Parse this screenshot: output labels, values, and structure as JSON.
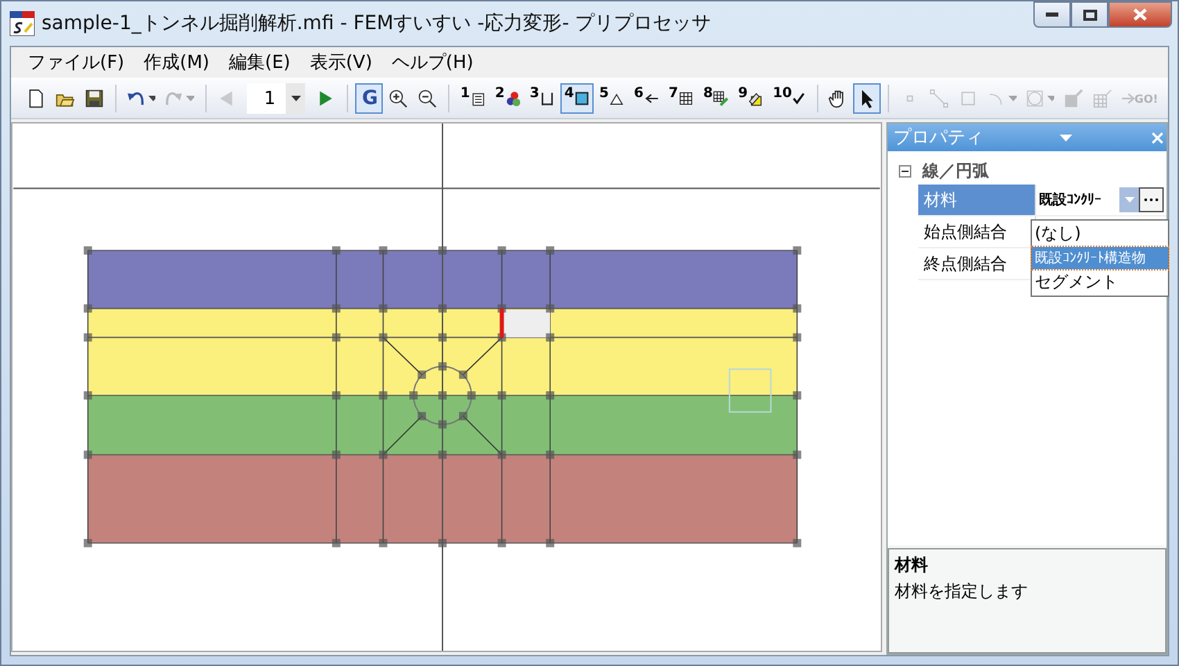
{
  "window": {
    "title": "sample-1_トンネル掘削解析.mfi - FEMすいすい -応力変形- プリプロセッサ"
  },
  "menu": [
    "ファイル(F)",
    "作成(M)",
    "編集(E)",
    "表示(V)",
    "ヘルプ(H)"
  ],
  "toolbar": [
    {
      "kind": "new",
      "disabled": false,
      "selected": false
    },
    {
      "kind": "open",
      "disabled": false,
      "selected": false
    },
    {
      "kind": "save",
      "disabled": false,
      "selected": false
    },
    {
      "kind": "sep"
    },
    {
      "kind": "undo",
      "disabled": false,
      "selected": false
    },
    {
      "kind": "redo",
      "disabled": true,
      "selected": false
    },
    {
      "kind": "sep"
    },
    {
      "kind": "prev",
      "disabled": true,
      "selected": false
    },
    {
      "kind": "page",
      "value": "1"
    },
    {
      "kind": "next",
      "disabled": false,
      "selected": false
    },
    {
      "kind": "sep"
    },
    {
      "kind": "global",
      "label": "G",
      "disabled": false,
      "selected": true
    },
    {
      "kind": "zoom-in",
      "disabled": false,
      "selected": false
    },
    {
      "kind": "zoom-out",
      "disabled": false,
      "selected": false
    },
    {
      "kind": "sep"
    },
    {
      "kind": "step-list",
      "label": "1",
      "disabled": false,
      "selected": false
    },
    {
      "kind": "step-circles",
      "label": "2",
      "disabled": false,
      "selected": false
    },
    {
      "kind": "step-dimension",
      "label": "3",
      "disabled": false,
      "selected": false
    },
    {
      "kind": "step-square",
      "label": "4",
      "disabled": false,
      "selected": true
    },
    {
      "kind": "step-triangle",
      "label": "5",
      "disabled": false,
      "selected": false
    },
    {
      "kind": "step-arrow",
      "label": "6",
      "disabled": false,
      "selected": false
    },
    {
      "kind": "step-grid",
      "label": "7",
      "disabled": false,
      "selected": false
    },
    {
      "kind": "step-grid-pencil",
      "label": "8",
      "disabled": false,
      "selected": false
    },
    {
      "kind": "step-pencil",
      "label": "9",
      "disabled": false,
      "selected": false
    },
    {
      "kind": "step-check",
      "label": "10",
      "disabled": false,
      "selected": false
    },
    {
      "kind": "sep"
    },
    {
      "kind": "hand",
      "disabled": false,
      "selected": false
    },
    {
      "kind": "pointer",
      "disabled": false,
      "selected": true
    },
    {
      "kind": "sep"
    },
    {
      "kind": "point",
      "disabled": true,
      "selected": false
    },
    {
      "kind": "line",
      "disabled": true,
      "selected": false
    },
    {
      "kind": "rect",
      "disabled": true,
      "selected": false
    },
    {
      "kind": "arc",
      "disabled": true,
      "selected": false
    },
    {
      "kind": "circle",
      "disabled": true,
      "selected": false
    },
    {
      "kind": "fill",
      "disabled": true,
      "selected": false
    },
    {
      "kind": "mesh",
      "disabled": true,
      "selected": false
    },
    {
      "kind": "go",
      "label": "GO!",
      "disabled": true,
      "selected": false
    }
  ],
  "canvas": {
    "layers": [
      {
        "color": "#7b7aba"
      },
      {
        "color": "#fbef7e"
      },
      {
        "color": "#82bf75"
      },
      {
        "color": "#c4827d"
      }
    ]
  },
  "properties": {
    "title": "プロパティ",
    "category": {
      "label": "線／円弧",
      "expanded": true
    },
    "rows": [
      {
        "name": "材料",
        "value": "既設ｺﾝｸﾘｰ",
        "selected": true
      },
      {
        "name": "始点側結合",
        "selected": false
      },
      {
        "name": "終点側結合",
        "selected": false
      }
    ],
    "dropdown": [
      {
        "label": "(なし)",
        "selected": false
      },
      {
        "label": "既設ｺﾝｸﾘｰﾄ構造物",
        "selected": true
      },
      {
        "label": "セグメント",
        "selected": false
      }
    ],
    "description": {
      "title": "材料",
      "text": "材料を指定します"
    }
  }
}
